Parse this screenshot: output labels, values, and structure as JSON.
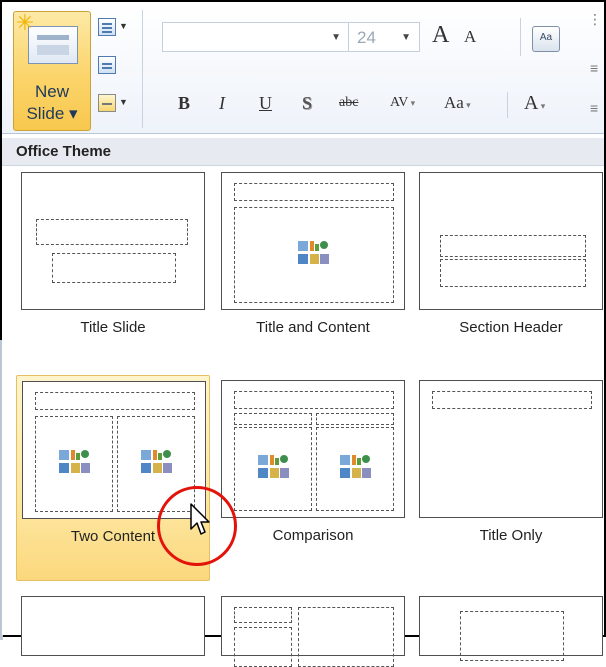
{
  "ribbon": {
    "new_slide_line1": "New",
    "new_slide_line2": "Slide ▾",
    "font_size": "24",
    "font_name": "",
    "grow_font": "A",
    "shrink_font": "A",
    "bold": "B",
    "italic": "I",
    "underline": "U",
    "shadow": "S",
    "strikethrough": "abc",
    "char_spacing": "AV",
    "change_case": "Aa",
    "font_color": "A"
  },
  "gallery": {
    "header": "Office Theme",
    "layouts": [
      {
        "label": "Title Slide"
      },
      {
        "label": "Title and Content"
      },
      {
        "label": "Section Header"
      },
      {
        "label": "Two Content"
      },
      {
        "label": "Comparison"
      },
      {
        "label": "Title Only"
      }
    ],
    "selected": "Two Content"
  },
  "colors": {
    "selection_fill": "#fde49a",
    "annotation_circle": "#e3120b",
    "ribbon_text": "#1e395b"
  }
}
